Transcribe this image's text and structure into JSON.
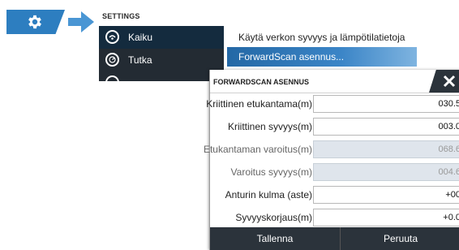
{
  "nav": {
    "gear_icon": "gear-icon",
    "arrow_icon": "arrow-right-icon",
    "accent": "#2d7ec0"
  },
  "settings": {
    "title": "SETTINGS",
    "left_items": [
      {
        "label": "Kaiku",
        "icon": "sonar-icon",
        "selected": true
      },
      {
        "label": "Tutka",
        "icon": "radar-icon",
        "selected": false
      }
    ],
    "right_items": [
      {
        "label": "Käytä verkon syvyys ja lämpötilatietoja",
        "active": false
      },
      {
        "label": "ForwardScan asennus...",
        "active": true
      }
    ]
  },
  "dialog": {
    "title": "FORWARDSCAN ASENNUS",
    "close_icon": "close-icon",
    "rows": [
      {
        "label": "Kriittinen etukantama(m)",
        "value": "030.5",
        "disabled": false
      },
      {
        "label": "Kriittinen syvyys(m)",
        "value": "003.0",
        "disabled": false
      },
      {
        "label": "Etukantaman varoitus(m)",
        "value": "068.6",
        "disabled": true
      },
      {
        "label": "Varoitus syvyys(m)",
        "value": "004.6",
        "disabled": true
      },
      {
        "label": "Anturin kulma (aste)",
        "value": "+00",
        "disabled": false
      },
      {
        "label": "Syvyyskorjaus(m)",
        "value": "+0.0",
        "disabled": false
      }
    ],
    "save_label": "Tallenna",
    "cancel_label": "Peruuta"
  }
}
